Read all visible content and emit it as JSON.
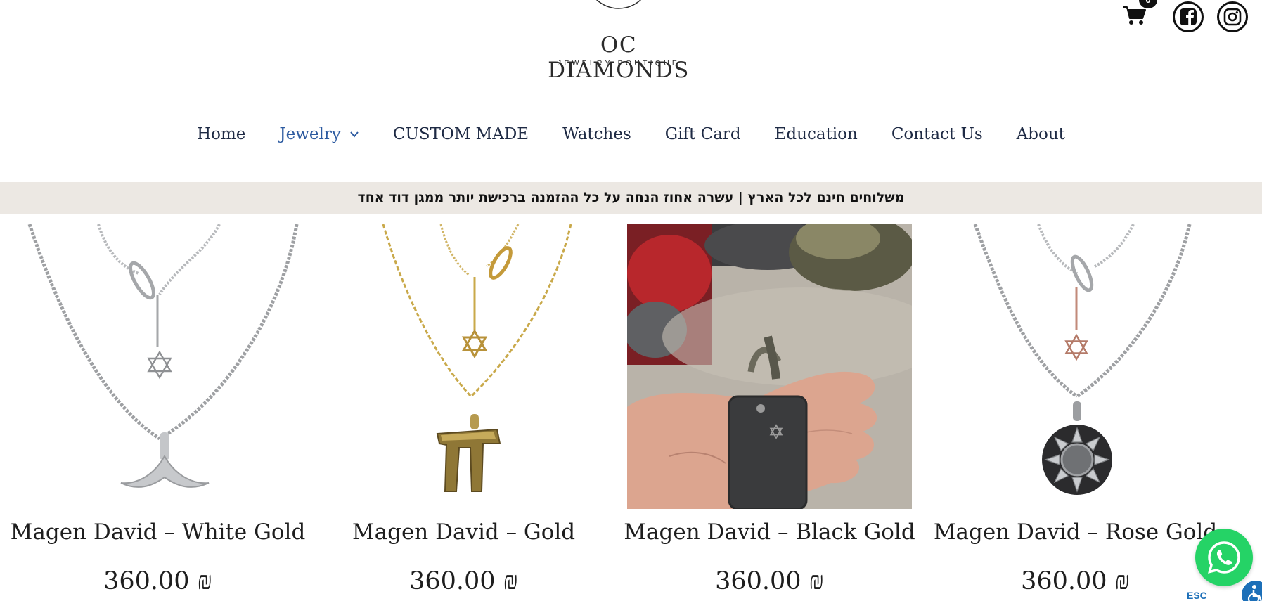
{
  "header": {
    "logo_title": "OC DIAMONDS",
    "logo_subtitle": "JEWELRY BOUTIQUE",
    "cart_count": "0",
    "icons": [
      "cart-icon",
      "facebook-icon",
      "instagram-icon"
    ]
  },
  "nav": {
    "items": [
      {
        "label": "Home",
        "active": false
      },
      {
        "label": "Jewelry",
        "active": true,
        "has_dropdown": true
      },
      {
        "label": "CUSTOM MADE",
        "active": false
      },
      {
        "label": "Watches",
        "active": false
      },
      {
        "label": "Gift Card",
        "active": false
      },
      {
        "label": "Education",
        "active": false
      },
      {
        "label": "Contact Us",
        "active": false
      },
      {
        "label": "About",
        "active": false
      }
    ]
  },
  "announcement": "משלוחים חינם לכל הארץ | עשרה אחוז הנחה על כל ההזמנה ברכישת יותר ממגן דוד אחד",
  "products": [
    {
      "title": "Magen David – White Gold",
      "price": "360.00 ₪"
    },
    {
      "title": "Magen David – Gold",
      "price": "360.00 ₪"
    },
    {
      "title": "Magen David – Black Gold",
      "price": "360.00 ₪"
    },
    {
      "title": "Magen David – Rose Gold",
      "price": "360.00 ₪"
    }
  ],
  "floating": {
    "esc_label": "ESC"
  },
  "colors": {
    "nav_text": "#1e2a44",
    "nav_active": "#2c5aa0",
    "announce_bg": "#ece8e3",
    "whatsapp": "#25d366",
    "accessibility": "#1c6fb8"
  }
}
